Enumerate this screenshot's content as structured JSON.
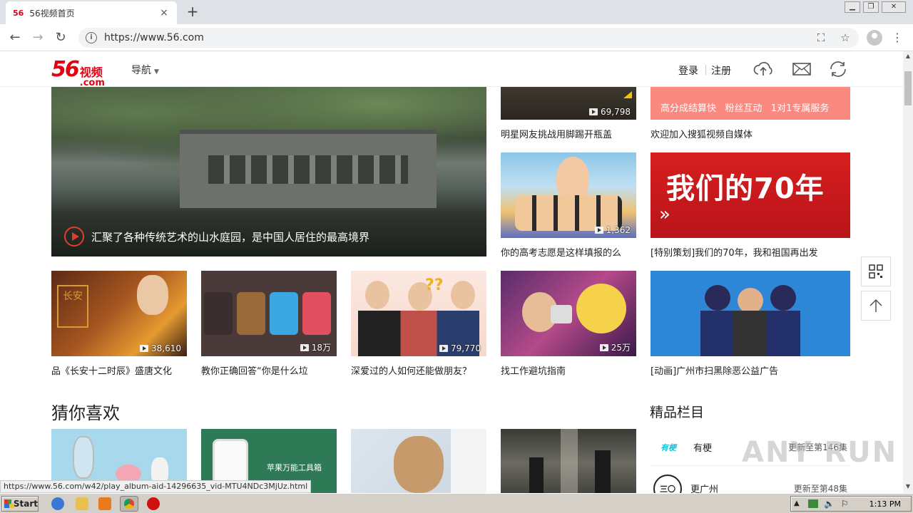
{
  "browser": {
    "tab_favicon": "56",
    "tab_title": "56视频首页",
    "tab_close": "×",
    "new_tab": "+",
    "url": "https://www.56.com",
    "status_url": "https://www.56.com/w42/play_album-aid-14296635_vid-MTU4NDc3MjUz.html"
  },
  "site": {
    "logo_56": "56",
    "logo_cn": "视频",
    "logo_com": ".com",
    "nav_label": "导航",
    "login": "登录",
    "register": "注册"
  },
  "hero": {
    "title": "汇聚了各种传统艺术的山水庭园，是中国人居住的最高境界"
  },
  "top_cards": [
    {
      "title": "明星网友挑战用脚踢开瓶盖",
      "count": "69,798"
    },
    {
      "title": "欢迎加入搜狐视频自媒体",
      "banner": "高分成结算快   粉丝互动   1对1专属服务"
    },
    {
      "title": "你的高考志愿是这样填报的么",
      "count": "1,362"
    },
    {
      "title": "[特别策划]我们的70年，我和祖国再出发",
      "banner": "我们的70年"
    }
  ],
  "row_cards": [
    {
      "title": "品《长安十二时辰》盛唐文化",
      "count": "38,610"
    },
    {
      "title": "教你正确回答“你是什么垃",
      "count": "18万"
    },
    {
      "title": "深爱过的人如何还能做朋友？",
      "count": "79,770"
    },
    {
      "title": "找工作避坑指南",
      "count": "25万"
    },
    {
      "title": "[动画]广州市扫黑除恶公益广告"
    }
  ],
  "section": {
    "guess_title": "猜你喜欢",
    "featured_title": "精品栏目"
  },
  "guess_cards": [
    {
      "caption": ""
    },
    {
      "caption": "苹果万能工具箱"
    },
    {
      "caption": ""
    },
    {
      "caption": ""
    }
  ],
  "programs": [
    {
      "logo": "有梗",
      "name": "有梗",
      "update": "更新至第146集"
    },
    {
      "logo": "三〇",
      "name": "更广州",
      "update": "更新至第48集"
    }
  ],
  "watermark": "ANY RUN",
  "taskbar": {
    "start": "Start",
    "clock": "1:13 PM"
  },
  "colors": {
    "brand_red": "#e50012",
    "hero_play": "#e53b2c"
  }
}
